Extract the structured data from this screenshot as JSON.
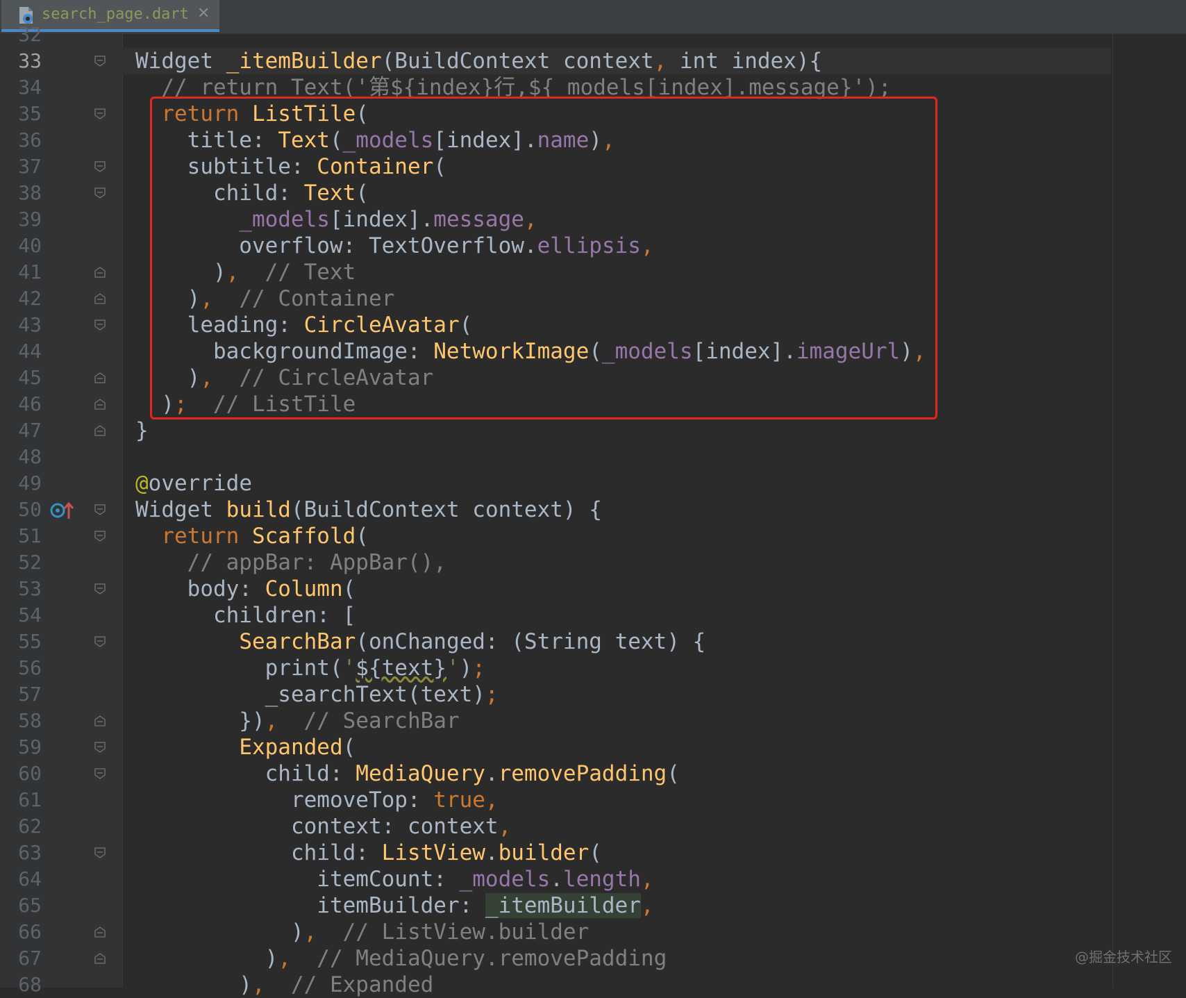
{
  "tab": {
    "filename": "search_page.dart",
    "close": "✕"
  },
  "icons": {
    "file": "dart-file-icon",
    "override": "override-method-icon"
  },
  "colors": {
    "highlight_box": "#e5261e",
    "keyword": "#cc7832",
    "function": "#ffc66d",
    "field": "#9876aa",
    "comment": "#808080"
  },
  "watermark": "@掘金技术社区",
  "lines": [
    {
      "n": "32",
      "code": ""
    },
    {
      "n": "33",
      "code": "Widget _itemBuilder(BuildContext context, int index){"
    },
    {
      "n": "34",
      "code": "  // return Text('第${index}行,${ models[index].message}');"
    },
    {
      "n": "35",
      "code": "  return ListTile("
    },
    {
      "n": "36",
      "code": "    title: Text(_models[index].name),"
    },
    {
      "n": "37",
      "code": "    subtitle: Container("
    },
    {
      "n": "38",
      "code": "      child: Text("
    },
    {
      "n": "39",
      "code": "        _models[index].message,"
    },
    {
      "n": "40",
      "code": "        overflow: TextOverflow.ellipsis,"
    },
    {
      "n": "41",
      "code": "      ),  // Text"
    },
    {
      "n": "42",
      "code": "    ),  // Container"
    },
    {
      "n": "43",
      "code": "    leading: CircleAvatar("
    },
    {
      "n": "44",
      "code": "      backgroundImage: NetworkImage(_models[index].imageUrl),"
    },
    {
      "n": "45",
      "code": "    ),  // CircleAvatar"
    },
    {
      "n": "46",
      "code": "  );  // ListTile"
    },
    {
      "n": "47",
      "code": "}"
    },
    {
      "n": "48",
      "code": ""
    },
    {
      "n": "49",
      "code": "@override"
    },
    {
      "n": "50",
      "code": "Widget build(BuildContext context) {"
    },
    {
      "n": "51",
      "code": "  return Scaffold("
    },
    {
      "n": "52",
      "code": "    // appBar: AppBar(),"
    },
    {
      "n": "53",
      "code": "    body: Column("
    },
    {
      "n": "54",
      "code": "      children: ["
    },
    {
      "n": "55",
      "code": "        SearchBar(onChanged: (String text) {"
    },
    {
      "n": "56",
      "code": "          print('${text}');"
    },
    {
      "n": "57",
      "code": "          _searchText(text);"
    },
    {
      "n": "58",
      "code": "        }),  // SearchBar"
    },
    {
      "n": "59",
      "code": "        Expanded("
    },
    {
      "n": "60",
      "code": "          child: MediaQuery.removePadding("
    },
    {
      "n": "61",
      "code": "            removeTop: true,"
    },
    {
      "n": "62",
      "code": "            context: context,"
    },
    {
      "n": "63",
      "code": "            child: ListView.builder("
    },
    {
      "n": "64",
      "code": "              itemCount: _models.length,"
    },
    {
      "n": "65",
      "code": "              itemBuilder: _itemBuilder,"
    },
    {
      "n": "66",
      "code": "            ),  // ListView.builder"
    },
    {
      "n": "67",
      "code": "          ),  // MediaQuery.removePadding"
    },
    {
      "n": "68",
      "code": "        ),  // Expanded"
    }
  ]
}
